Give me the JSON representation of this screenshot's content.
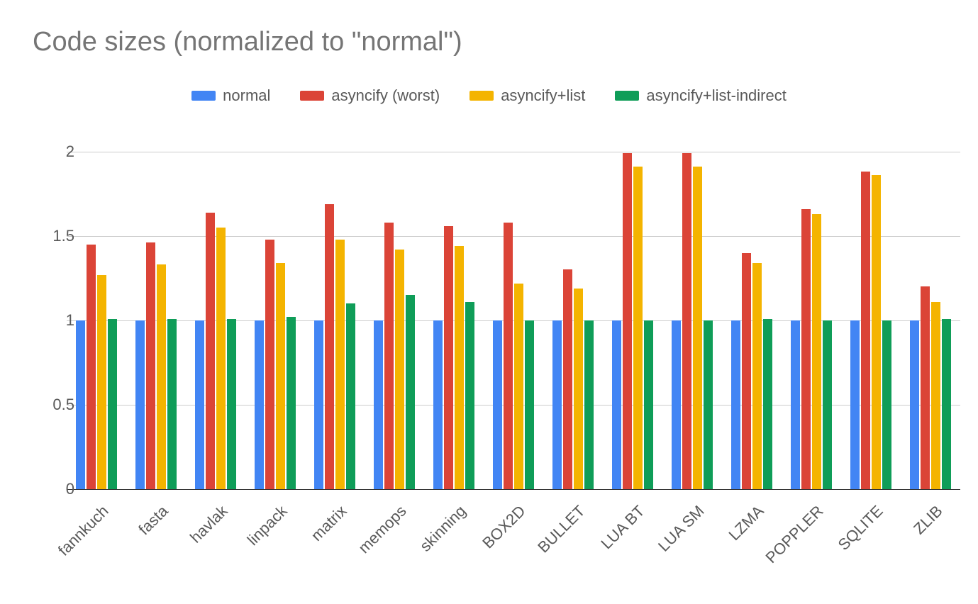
{
  "title": "Code sizes (normalized to \"normal\")",
  "colors": {
    "normal": "#4285F4",
    "asyncify_worst": "#DB4437",
    "asyncify_list": "#F4B400",
    "asyncify_list_indirect": "#0F9D58"
  },
  "legend": [
    {
      "label": "normal",
      "colorKey": "normal"
    },
    {
      "label": "asyncify (worst)",
      "colorKey": "asyncify_worst"
    },
    {
      "label": "asyncify+list",
      "colorKey": "asyncify_list"
    },
    {
      "label": "asyncify+list-indirect",
      "colorKey": "asyncify_list_indirect"
    }
  ],
  "yticks": [
    0,
    0.5,
    1,
    1.5,
    2
  ],
  "chart_data": {
    "type": "bar",
    "title": "Code sizes (normalized to \"normal\")",
    "xlabel": "",
    "ylabel": "",
    "ylim": [
      0,
      2.1
    ],
    "categories": [
      "fannkuch",
      "fasta",
      "havlak",
      "linpack",
      "matrix",
      "memops",
      "skinning",
      "BOX2D",
      "BULLET",
      "LUA BT",
      "LUA SM",
      "LZMA",
      "POPPLER",
      "SQLITE",
      "ZLIB"
    ],
    "series": [
      {
        "name": "normal",
        "values": [
          1.0,
          1.0,
          1.0,
          1.0,
          1.0,
          1.0,
          1.0,
          1.0,
          1.0,
          1.0,
          1.0,
          1.0,
          1.0,
          1.0,
          1.0
        ]
      },
      {
        "name": "asyncify (worst)",
        "values": [
          1.45,
          1.46,
          1.64,
          1.48,
          1.69,
          1.58,
          1.56,
          1.58,
          1.3,
          1.99,
          1.99,
          1.4,
          1.66,
          1.88,
          1.2
        ]
      },
      {
        "name": "asyncify+list",
        "values": [
          1.27,
          1.33,
          1.55,
          1.34,
          1.48,
          1.42,
          1.44,
          1.22,
          1.19,
          1.91,
          1.91,
          1.34,
          1.63,
          1.86,
          1.11
        ]
      },
      {
        "name": "asyncify+list-indirect",
        "values": [
          1.01,
          1.01,
          1.01,
          1.02,
          1.1,
          1.15,
          1.11,
          1.0,
          1.0,
          1.0,
          1.0,
          1.01,
          1.0,
          1.0,
          1.01
        ]
      }
    ]
  }
}
